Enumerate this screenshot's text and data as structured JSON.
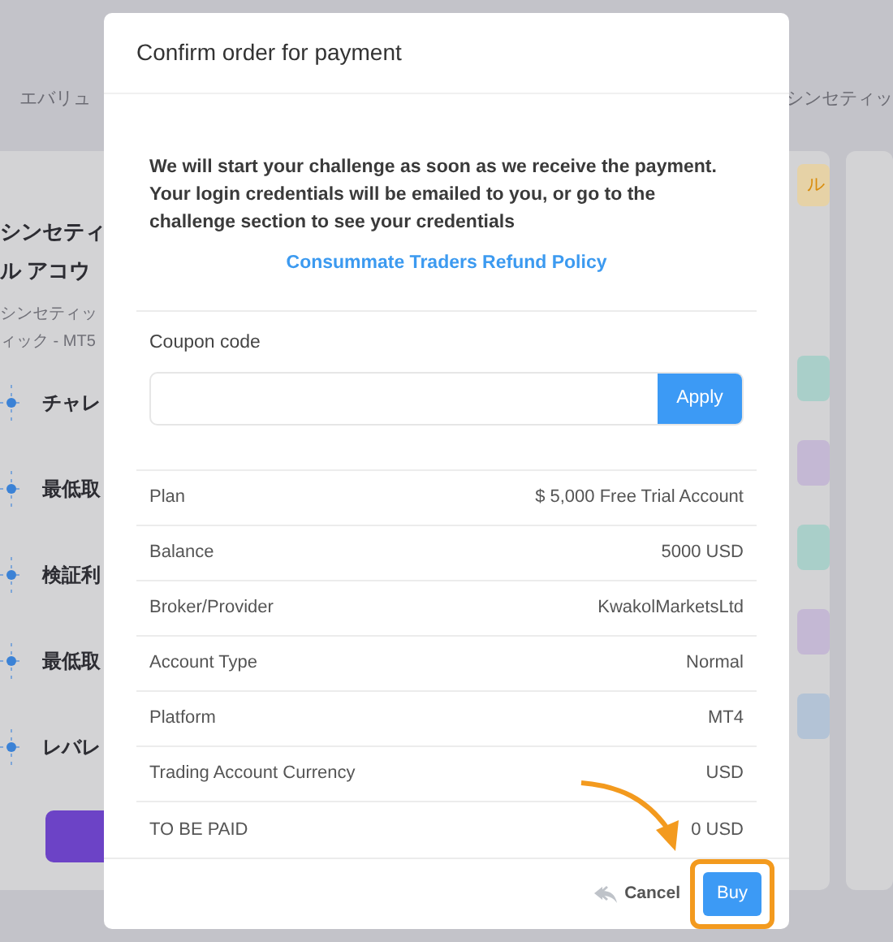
{
  "background": {
    "breadcrumb": "エバリュ",
    "breadcrumb_right": "シンセティッ",
    "card": {
      "title_lines": [
        "シンセティ",
        "ル アコウ"
      ],
      "subtitle_lines": [
        "シンセティッ",
        "ィック - MT5"
      ],
      "features": [
        "チャレ",
        "最低取",
        "検証利",
        "最低取",
        "レバレ"
      ]
    },
    "badge": "ル",
    "side_tags": [
      {
        "color": "#a9cfc9"
      },
      {
        "color": "#c4b8d4"
      },
      {
        "color": "#a9cfc9"
      },
      {
        "color": "#c4b8d4"
      },
      {
        "color": "#b3c3d6"
      }
    ]
  },
  "modal": {
    "title": "Confirm order for payment",
    "message": "We will start your challenge as soon as we receive the payment. Your login credentials will be emailed to you, or go to the challenge section to see your credentials",
    "refund_link": "Consummate Traders Refund Policy",
    "coupon": {
      "label": "Coupon code",
      "button": "Apply"
    },
    "summary": [
      {
        "label": "Plan",
        "value": "$ 5,000 Free Trial Account"
      },
      {
        "label": "Balance",
        "value": "5000 USD"
      },
      {
        "label": "Broker/Provider",
        "value": "KwakolMarketsLtd"
      },
      {
        "label": "Account Type",
        "value": "Normal"
      },
      {
        "label": "Platform",
        "value": "MT4"
      },
      {
        "label": "Trading Account Currency",
        "value": "USD"
      },
      {
        "label": "TO BE PAID",
        "value": "0 USD"
      }
    ],
    "cancel": "Cancel",
    "buy": "Buy",
    "buy_highlighted": true
  }
}
